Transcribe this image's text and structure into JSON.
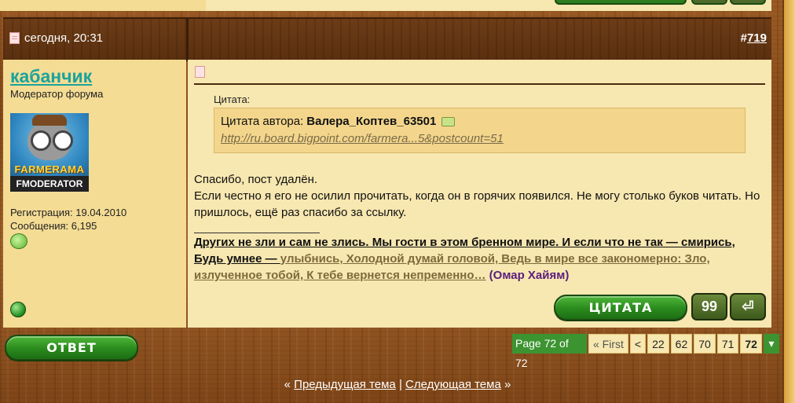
{
  "post": {
    "date": "сегодня, 20:31",
    "number_prefix": "#",
    "number": "719"
  },
  "user": {
    "name": "кабанчик",
    "title": "Модератор форума",
    "avatar_text_top": "FARMERAMA",
    "avatar_text_bottom": "FMODERATOR",
    "registration": "Регистрация: 19.04.2010",
    "messages": "Сообщения: 6,195"
  },
  "quote": {
    "label": "Цитата:",
    "author_prefix": "Цитата автора: ",
    "author": "Валера_Коптев_63501",
    "link": "http://ru.board.bigpoint.com/farmera...5&postcount=51"
  },
  "message": {
    "line1": "Спасибо, пост удалён.",
    "line2": "Если честно я его не осилил прочитать, когда он в горячих появился. Не могу столько буков читать. Но пришлось, ещё раз спасибо за ссылку."
  },
  "signature": {
    "part1": "Других не зли и сам не злись. Мы гости в этом бренном мире. И если что не так — смирись, Будь умнее — ",
    "part2": "улыбнись, Холодной думай головой, Ведь в мире все закономерно: Зло, излученное тобой, К тебе вернется непременно…",
    "part3": " (Омар Хайям)"
  },
  "buttons": {
    "quote": "ЦИТАТА",
    "reply": "ОТВЕТ",
    "multiquote": "99",
    "back": "⏎"
  },
  "pagination": {
    "info": "Page 72 of 72",
    "first": "« First",
    "prev": "<",
    "pages": [
      "22",
      "62",
      "70",
      "71",
      "72"
    ],
    "dropdown": "▾"
  },
  "thread_nav": {
    "left_mark": "«",
    "prev": "Предыдущая тема",
    "sep": "|",
    "next": "Следующая тема",
    "right_mark": "»"
  }
}
